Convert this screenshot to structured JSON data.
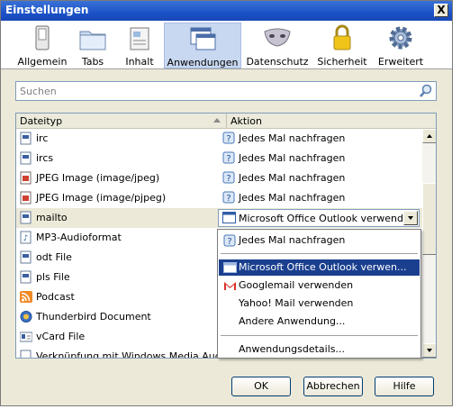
{
  "window": {
    "title": "Einstellungen",
    "close_label": "X"
  },
  "toolbar": {
    "items": [
      {
        "label": "Allgemein",
        "icon": "switch-icon"
      },
      {
        "label": "Tabs",
        "icon": "folder-tabs-icon"
      },
      {
        "label": "Inhalt",
        "icon": "content-icon"
      },
      {
        "label": "Anwendungen",
        "icon": "applications-icon",
        "selected": true
      },
      {
        "label": "Datenschutz",
        "icon": "mask-icon"
      },
      {
        "label": "Sicherheit",
        "icon": "padlock-icon"
      },
      {
        "label": "Erweitert",
        "icon": "gear-icon"
      }
    ]
  },
  "search": {
    "placeholder": "Suchen"
  },
  "table": {
    "col_type": "Dateityp",
    "col_action": "Aktion",
    "rows": [
      {
        "type": "irc",
        "action": "Jedes Mal nachfragen"
      },
      {
        "type": "ircs",
        "action": "Jedes Mal nachfragen"
      },
      {
        "type": "JPEG Image (image/jpeg)",
        "action": "Jedes Mal nachfragen"
      },
      {
        "type": "JPEG Image (image/pjpeg)",
        "action": "Jedes Mal nachfragen"
      },
      {
        "type": "mailto",
        "action": "Microsoft Office Outlook verwende..."
      },
      {
        "type": "MP3-Audioformat"
      },
      {
        "type": "odt File"
      },
      {
        "type": "pls File"
      },
      {
        "type": "Podcast"
      },
      {
        "type": "Thunderbird Document"
      },
      {
        "type": "vCard File"
      },
      {
        "type": "Verknüpfung mit Windows Media Audio"
      }
    ]
  },
  "dropdown": {
    "items": [
      "Jedes Mal nachfragen",
      "Microsoft Office Outlook verwen...",
      "Googlemail verwenden",
      "Yahoo! Mail verwenden",
      "Andere Anwendung...",
      "Anwendungsdetails..."
    ]
  },
  "buttons": {
    "ok": "OK",
    "cancel": "Abbrechen",
    "help": "Hilfe"
  },
  "colors": {
    "titlebar": "#1b52c8",
    "selected_item": "#1a3f8f",
    "selected_tab": "#c8d8f0"
  }
}
